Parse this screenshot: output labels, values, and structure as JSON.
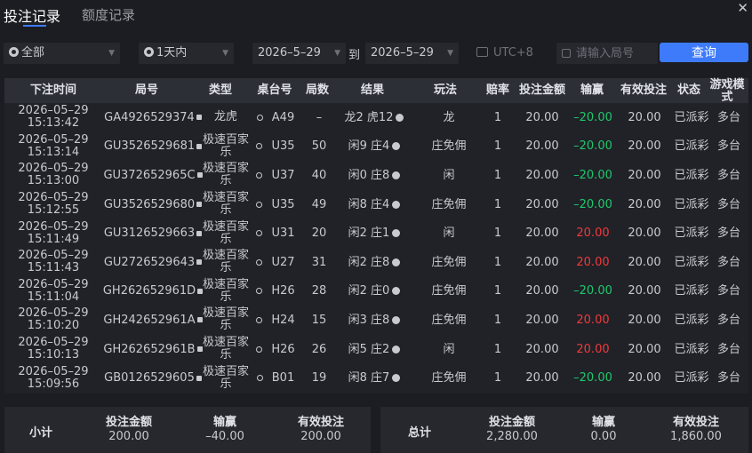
{
  "tabs": [
    {
      "label": "投注记录"
    },
    {
      "label": "额度记录"
    }
  ],
  "filters": {
    "game": "全部",
    "period": "1天内",
    "date_from": "2026–5–29",
    "to_label": "到",
    "date_to": "2026–5–29",
    "timezone": "UTC+8",
    "round_placeholder": "请输入局号",
    "query_label": "查询"
  },
  "columns": [
    "下注时间",
    "局号",
    "类型",
    "桌台号",
    "局数",
    "结果",
    "玩法",
    "赔率",
    "投注金额",
    "输赢",
    "有效投注",
    "状态",
    "游戏模式"
  ],
  "rows": [
    {
      "date": "2026–05–29",
      "time": "15:13:42",
      "id": "GA4926529374",
      "type": "龙虎",
      "table": "A49",
      "round": "–",
      "result": "龙2 虎12",
      "play": "龙",
      "odds": "1",
      "bet": "20.00",
      "win": "–20.00",
      "valid": "20.00",
      "status": "已派彩",
      "mode": "多台"
    },
    {
      "date": "2026–05–29",
      "time": "15:13:14",
      "id": "GU3526529681",
      "type": "极速百家乐",
      "table": "U35",
      "round": "50",
      "result": "闲9 庄4",
      "play": "庄免佣",
      "odds": "1",
      "bet": "20.00",
      "win": "–20.00",
      "valid": "20.00",
      "status": "已派彩",
      "mode": "多台"
    },
    {
      "date": "2026–05–29",
      "time": "15:13:00",
      "id": "GU372652965C",
      "type": "极速百家乐",
      "table": "U37",
      "round": "40",
      "result": "闲0 庄8",
      "play": "闲",
      "odds": "1",
      "bet": "20.00",
      "win": "–20.00",
      "valid": "20.00",
      "status": "已派彩",
      "mode": "多台"
    },
    {
      "date": "2026–05–29",
      "time": "15:12:55",
      "id": "GU3526529680",
      "type": "极速百家乐",
      "table": "U35",
      "round": "49",
      "result": "闲8 庄4",
      "play": "庄免佣",
      "odds": "1",
      "bet": "20.00",
      "win": "–20.00",
      "valid": "20.00",
      "status": "已派彩",
      "mode": "多台"
    },
    {
      "date": "2026–05–29",
      "time": "15:11:49",
      "id": "GU3126529663",
      "type": "极速百家乐",
      "table": "U31",
      "round": "20",
      "result": "闲2 庄1",
      "play": "闲",
      "odds": "1",
      "bet": "20.00",
      "win": "20.00",
      "valid": "20.00",
      "status": "已派彩",
      "mode": "多台"
    },
    {
      "date": "2026–05–29",
      "time": "15:11:43",
      "id": "GU2726529643",
      "type": "极速百家乐",
      "table": "U27",
      "round": "31",
      "result": "闲2 庄8",
      "play": "庄免佣",
      "odds": "1",
      "bet": "20.00",
      "win": "20.00",
      "valid": "20.00",
      "status": "已派彩",
      "mode": "多台"
    },
    {
      "date": "2026–05–29",
      "time": "15:11:04",
      "id": "GH262652961D",
      "type": "极速百家乐",
      "table": "H26",
      "round": "28",
      "result": "闲2 庄0",
      "play": "庄免佣",
      "odds": "1",
      "bet": "20.00",
      "win": "–20.00",
      "valid": "20.00",
      "status": "已派彩",
      "mode": "多台"
    },
    {
      "date": "2026–05–29",
      "time": "15:10:20",
      "id": "GH242652961A",
      "type": "极速百家乐",
      "table": "H24",
      "round": "15",
      "result": "闲3 庄8",
      "play": "庄免佣",
      "odds": "1",
      "bet": "20.00",
      "win": "20.00",
      "valid": "20.00",
      "status": "已派彩",
      "mode": "多台"
    },
    {
      "date": "2026–05–29",
      "time": "15:10:13",
      "id": "GH262652961B",
      "type": "极速百家乐",
      "table": "H26",
      "round": "26",
      "result": "闲5 庄2",
      "play": "闲",
      "odds": "1",
      "bet": "20.00",
      "win": "20.00",
      "valid": "20.00",
      "status": "已派彩",
      "mode": "多台"
    },
    {
      "date": "2026–05–29",
      "time": "15:09:56",
      "id": "GB0126529605",
      "type": "极速百家乐",
      "table": "B01",
      "round": "19",
      "result": "闲8 庄7",
      "play": "庄免佣",
      "odds": "1",
      "bet": "20.00",
      "win": "–20.00",
      "valid": "20.00",
      "status": "已派彩",
      "mode": "多台"
    }
  ],
  "subtotal": {
    "label": "小计",
    "bet_label": "投注金额",
    "bet": "200.00",
    "win_label": "输赢",
    "win": "–40.00",
    "valid_label": "有效投注",
    "valid": "200.00"
  },
  "total": {
    "label": "总计",
    "bet_label": "投注金额",
    "bet": "2,280.00",
    "win_label": "输赢",
    "win": "0.00",
    "valid_label": "有效投注",
    "valid": "1,860.00"
  },
  "colors": {
    "accent": "#3e7bfa",
    "loss": "#1fc86a",
    "gain": "#f03a3a",
    "background": "#1b1d22"
  }
}
